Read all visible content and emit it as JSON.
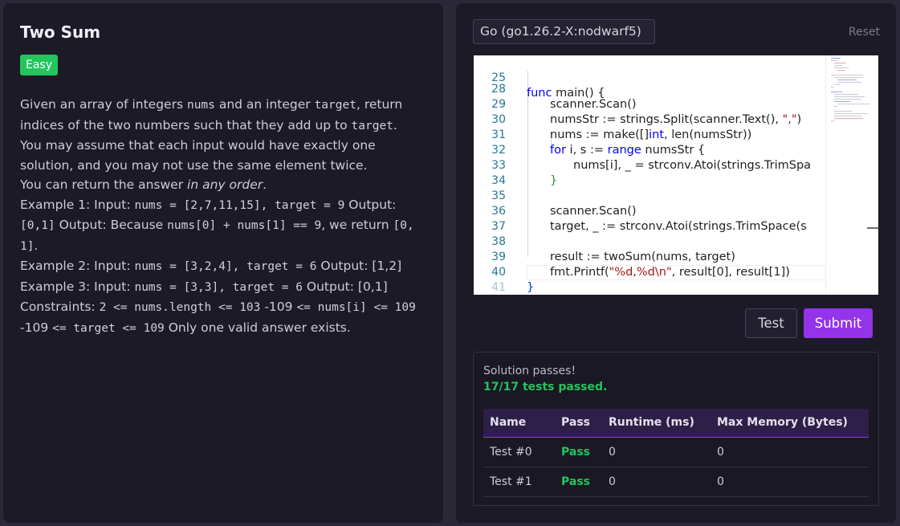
{
  "problem": {
    "title": "Two Sum",
    "difficulty": "Easy",
    "desc": {
      "p1_a": "Given an array of integers ",
      "p1_b": "nums",
      "p1_c": " and an integer ",
      "p1_d": "target",
      "p1_e": ", return indices of the two numbers such that they add up to ",
      "p1_f": "target",
      "p1_g": ".",
      "p2": "You may assume that each input would have exactly one solution, and you may not use the same element twice.",
      "p3_a": "You can return the answer ",
      "p3_b": "in any order",
      "p3_c": ".",
      "ex1_a": "Example 1: Input: ",
      "ex1_b": "nums = [2,7,11,15], target = 9",
      "ex1_c": " Output: ",
      "ex1_d": "[0,1]",
      "ex1_e": " Output: Because ",
      "ex1_f": "nums[0] + nums[1] == 9",
      "ex1_g": ", we return ",
      "ex1_h": "[0, 1]",
      "ex1_i": ".",
      "ex2_a": "Example 2: Input: ",
      "ex2_b": "nums = [3,2,4], target = 6",
      "ex2_c": " Output: [1,2]",
      "ex3_a": "Example 3: Input: ",
      "ex3_b": "nums = [3,3], target = 6",
      "ex3_c": " Output: [0,1]",
      "c_a": "Constraints: ",
      "c_b": "2 <= nums.length <= 103",
      "c_c": " -109 ",
      "c_d": "<= nums[i] <= 109",
      "c_e": " -109 ",
      "c_f": "<= target <= 109",
      "c_g": " Only one valid answer exists."
    }
  },
  "editor": {
    "language": "Go (go1.26.2-X:nodwarf5)",
    "reset_label": "Reset",
    "line_numbers": [
      "25",
      "28",
      "29",
      "30",
      "31",
      "32",
      "33",
      "34",
      "35",
      "36",
      "37",
      "38",
      "39",
      "40",
      "41"
    ],
    "code": {
      "l25_a": "func",
      "l25_b": " main() {",
      "l28": "scanner.Scan()",
      "l29_a": "numsStr := strings.Split(scanner.Text(), ",
      "l29_b": "\",\"",
      "l29_c": ")",
      "l30_a": "nums := make([]",
      "l30_b": "int",
      "l30_c": ", len(numsStr))",
      "l31_a": "for",
      "l31_b": " i, s := ",
      "l31_c": "range",
      "l31_d": " numsStr {",
      "l32": "nums[i], _ = strconv.Atoi(strings.TrimSpa",
      "l33": "}",
      "l35": "scanner.Scan()",
      "l36": "target, _ := strconv.Atoi(strings.TrimSpace(s",
      "l38": "result := twoSum(nums, target)",
      "l39_a": "fmt.Printf(",
      "l39_b": "\"%d,%d\\n\"",
      "l39_c": ", result[0], result[1])",
      "l40": "}"
    }
  },
  "actions": {
    "test_label": "Test",
    "submit_label": "Submit"
  },
  "results": {
    "message": "Solution passes!",
    "summary": "17/17 tests passed.",
    "columns": [
      "Name",
      "Pass",
      "Runtime (ms)",
      "Max Memory (Bytes)"
    ],
    "rows": [
      {
        "name": "Test #0",
        "pass": "Pass",
        "runtime": "0",
        "memory": "0"
      },
      {
        "name": "Test #1",
        "pass": "Pass",
        "runtime": "0",
        "memory": "0"
      }
    ]
  },
  "colors": {
    "accent": "#9333ea",
    "success": "#22c55e",
    "panel": "#1c1a26",
    "background": "#2b2838"
  }
}
